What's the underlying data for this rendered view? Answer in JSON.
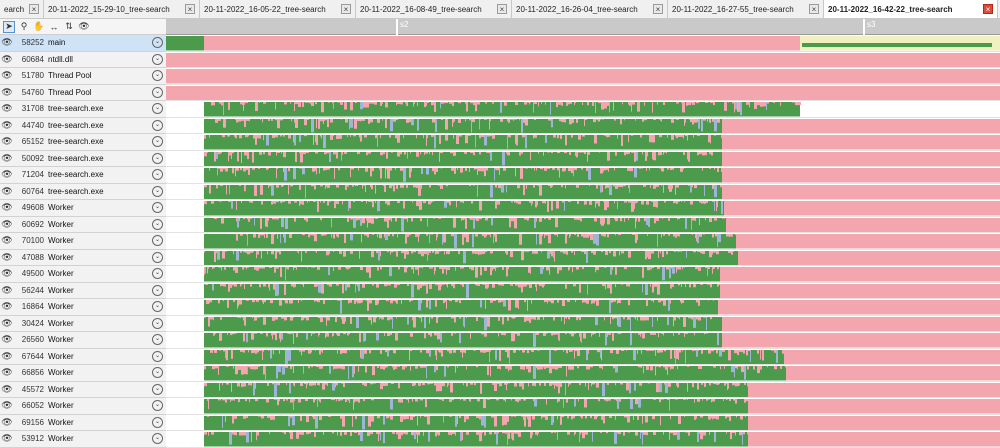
{
  "tabs": [
    {
      "label": "earch",
      "active": false
    },
    {
      "label": "20-11-2022_15-29-10_tree-search",
      "active": false
    },
    {
      "label": "20-11-2022_16-05-22_tree-search",
      "active": false
    },
    {
      "label": "20-11-2022_16-08-49_tree-search",
      "active": false
    },
    {
      "label": "20-11-2022_16-26-04_tree-search",
      "active": false
    },
    {
      "label": "20-11-2022_16-27-55_tree-search",
      "active": false
    },
    {
      "label": "20-11-2022_16-42-22_tree-search",
      "active": true
    }
  ],
  "tab_nav": {
    "left": "◀",
    "right": "▶"
  },
  "toolbar": {
    "icons": [
      "cursor-icon",
      "magnifier-icon",
      "hand-icon",
      "horizontal-zoom-icon",
      "sort-icon",
      "eye-menu-icon"
    ]
  },
  "ruler": {
    "labels": [
      "s2",
      "s3"
    ]
  },
  "colors": {
    "running": "#4c9b4c",
    "waiting": "#f4a6ae",
    "blocked": "#9db6d6",
    "idle": "#f0f0c0",
    "marker": "#6a2a2a"
  },
  "threads": [
    {
      "id": "58252",
      "name": "main",
      "selected": true
    },
    {
      "id": "60684",
      "name": "ntdll.dll"
    },
    {
      "id": "51780",
      "name": "Thread Pool"
    },
    {
      "id": "54760",
      "name": "Thread Pool"
    },
    {
      "id": "31708",
      "name": "tree-search.exe"
    },
    {
      "id": "44740",
      "name": "tree-search.exe"
    },
    {
      "id": "65152",
      "name": "tree-search.exe"
    },
    {
      "id": "50092",
      "name": "tree-search.exe"
    },
    {
      "id": "71204",
      "name": "tree-search.exe"
    },
    {
      "id": "60764",
      "name": "tree-search.exe"
    },
    {
      "id": "49608",
      "name": "Worker"
    },
    {
      "id": "60692",
      "name": "Worker"
    },
    {
      "id": "70100",
      "name": "Worker"
    },
    {
      "id": "47088",
      "name": "Worker"
    },
    {
      "id": "49500",
      "name": "Worker"
    },
    {
      "id": "56244",
      "name": "Worker"
    },
    {
      "id": "16864",
      "name": "Worker"
    },
    {
      "id": "30424",
      "name": "Worker"
    },
    {
      "id": "26560",
      "name": "Worker"
    },
    {
      "id": "67644",
      "name": "Worker"
    },
    {
      "id": "66856",
      "name": "Worker"
    },
    {
      "id": "45572",
      "name": "Worker"
    },
    {
      "id": "66052",
      "name": "Worker"
    },
    {
      "id": "69156",
      "name": "Worker"
    },
    {
      "id": "53912",
      "name": "Worker"
    }
  ]
}
